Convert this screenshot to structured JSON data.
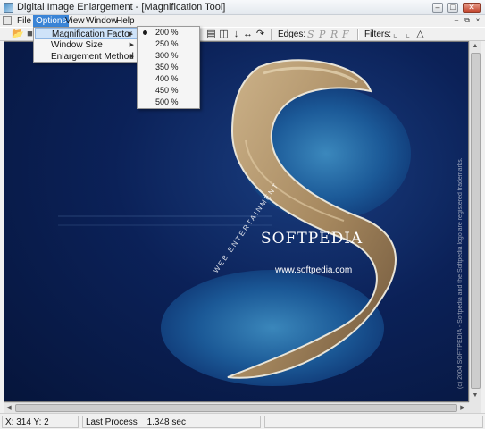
{
  "window": {
    "title": "Digital Image Enlargement - [Magnification Tool]"
  },
  "menubar": {
    "items": [
      "File",
      "Options",
      "View",
      "Window",
      "Help"
    ]
  },
  "options_menu": {
    "items": [
      "Magnification Factor",
      "Window Size",
      "Enlargement Method"
    ]
  },
  "magnification_submenu": {
    "selected": "200 %",
    "items": [
      "200 %",
      "250 %",
      "300 %",
      "350 %",
      "400 %",
      "450 %",
      "500 %"
    ]
  },
  "toolbar": {
    "edges_label": "Edges:",
    "edge_letters": [
      "S",
      "P",
      "R",
      "F"
    ],
    "filters_label": "Filters:"
  },
  "image": {
    "brand": "SOFTPEDIA",
    "url": "www.softpedia.com",
    "tagline": "WEB ENTERTAINMENT",
    "trademark": "(c) 2004 SOFTPEDIA - Softpedia and the Softpedia logo are registered trademarks."
  },
  "statusbar": {
    "coords": "X: 314  Y: 2",
    "process_label": "Last Process",
    "process_time": "1.348 sec"
  },
  "colors": {
    "menu_highlight": "#3a84d6",
    "ocean": "#0b2158",
    "island": "#b99c72"
  }
}
